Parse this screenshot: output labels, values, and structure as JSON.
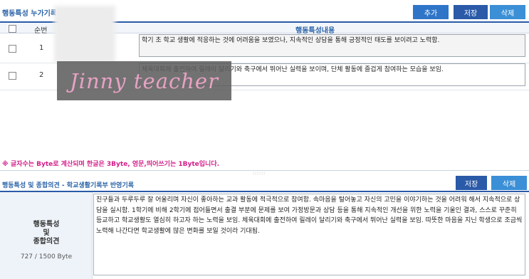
{
  "top": {
    "title": "행동특성 누가기록",
    "buttons": {
      "add": "추가",
      "save": "저장",
      "delete": "삭제"
    }
  },
  "table": {
    "headers": {
      "num": "순번",
      "content": "행동특성내용"
    },
    "rows": [
      {
        "num": "1",
        "content": "학기 초 학교 생활에 적응하는 것에 어려움을 보였으나, 지속적인 상담을 통해 긍정적인 태도를 보이려고 노력함."
      },
      {
        "num": "2",
        "content": "체육대회에 출전하여 릴레이 달리기와 축구에서 뛰어난 실력을 보이며, 단체 활동에 즐겁게 참여하는 모습을 보임."
      }
    ]
  },
  "watermark": "Jinny teacher",
  "note": "※ 글자수는 Byte로 계산되며 한글은 3Byte, 영문,띄어쓰기는 1Byte입니다.",
  "divider_dots": "::::::",
  "section2": {
    "title": "행동특성 및 종합의견 - 학교생활기록부 반영기록",
    "buttons": {
      "save": "저장",
      "delete": "삭제"
    },
    "label_lines": [
      "행동특성",
      "및",
      "종합의견"
    ],
    "byte_count": "727 / 1500 Byte",
    "text": "친구들과 두루두루 잘 어울리며 자신이 좋아하는 교과 활동에 적극적으로 참여함. 속마음을 털어놓고 자신의 고민을 이야기하는 것을 어려워 해서 지속적으로 상담을 실시함. 1학기에 비해 2학기에 접어들면서 출결 부분에 문제를 보여 가정방문과 상담 등을 통해 지속적인 개선을 위한 노력을 기울인 결과, 스스로 꾸준히 등교하고 학교생활도 열심히 하고자 하는 노력을 보임. 체육대회에 출전하여 릴레이 달리기와 축구에서 뛰어난 실력을 보임. 따뜻한 마음을 지닌 학생으로 조금씩 노력해 나간다면 학교생활에 많은 변화를 보일 것이라 기대됨."
  },
  "colors": {
    "accent": "#2a5aa8",
    "note": "#d31f89",
    "label_bg": "#eef3f9"
  }
}
